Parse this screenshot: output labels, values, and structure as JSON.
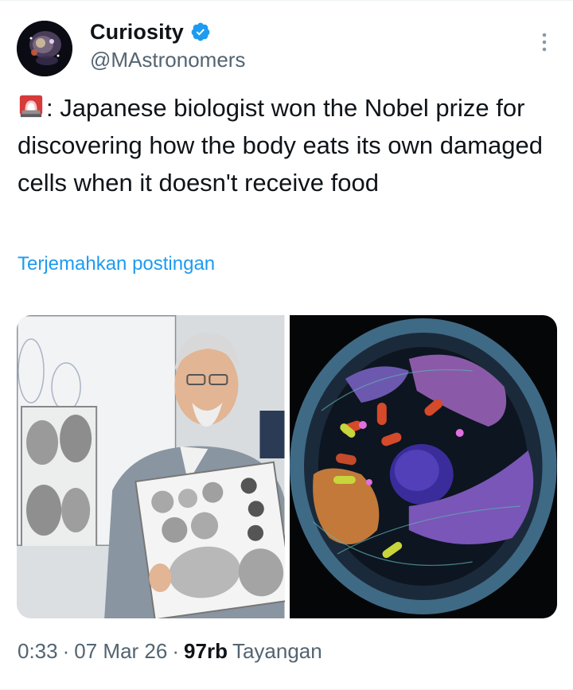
{
  "author": {
    "display_name": "Curiosity",
    "handle": "@MAstronomers",
    "verified": true,
    "avatar_icon": "galaxy-avatar"
  },
  "post": {
    "emoji_icon": "siren-icon",
    "text": ": Japanese biologist won the Nobel prize for discovering how the body eats its own damaged cells when it doesn't receive food",
    "translate_label": "Terjemahkan postingan"
  },
  "media": [
    {
      "description_icon": "photo-scientist-holding-micrographs"
    },
    {
      "description_icon": "photo-cell-illustration"
    }
  ],
  "meta": {
    "time": "0:33",
    "separator": "·",
    "date": "07 Mar 26",
    "views_count": "97rb",
    "views_label": "Tayangan"
  },
  "colors": {
    "link": "#1d9bf0",
    "verified": "#1d9bf0",
    "secondary_text": "#536471",
    "primary_text": "#0f1419"
  }
}
